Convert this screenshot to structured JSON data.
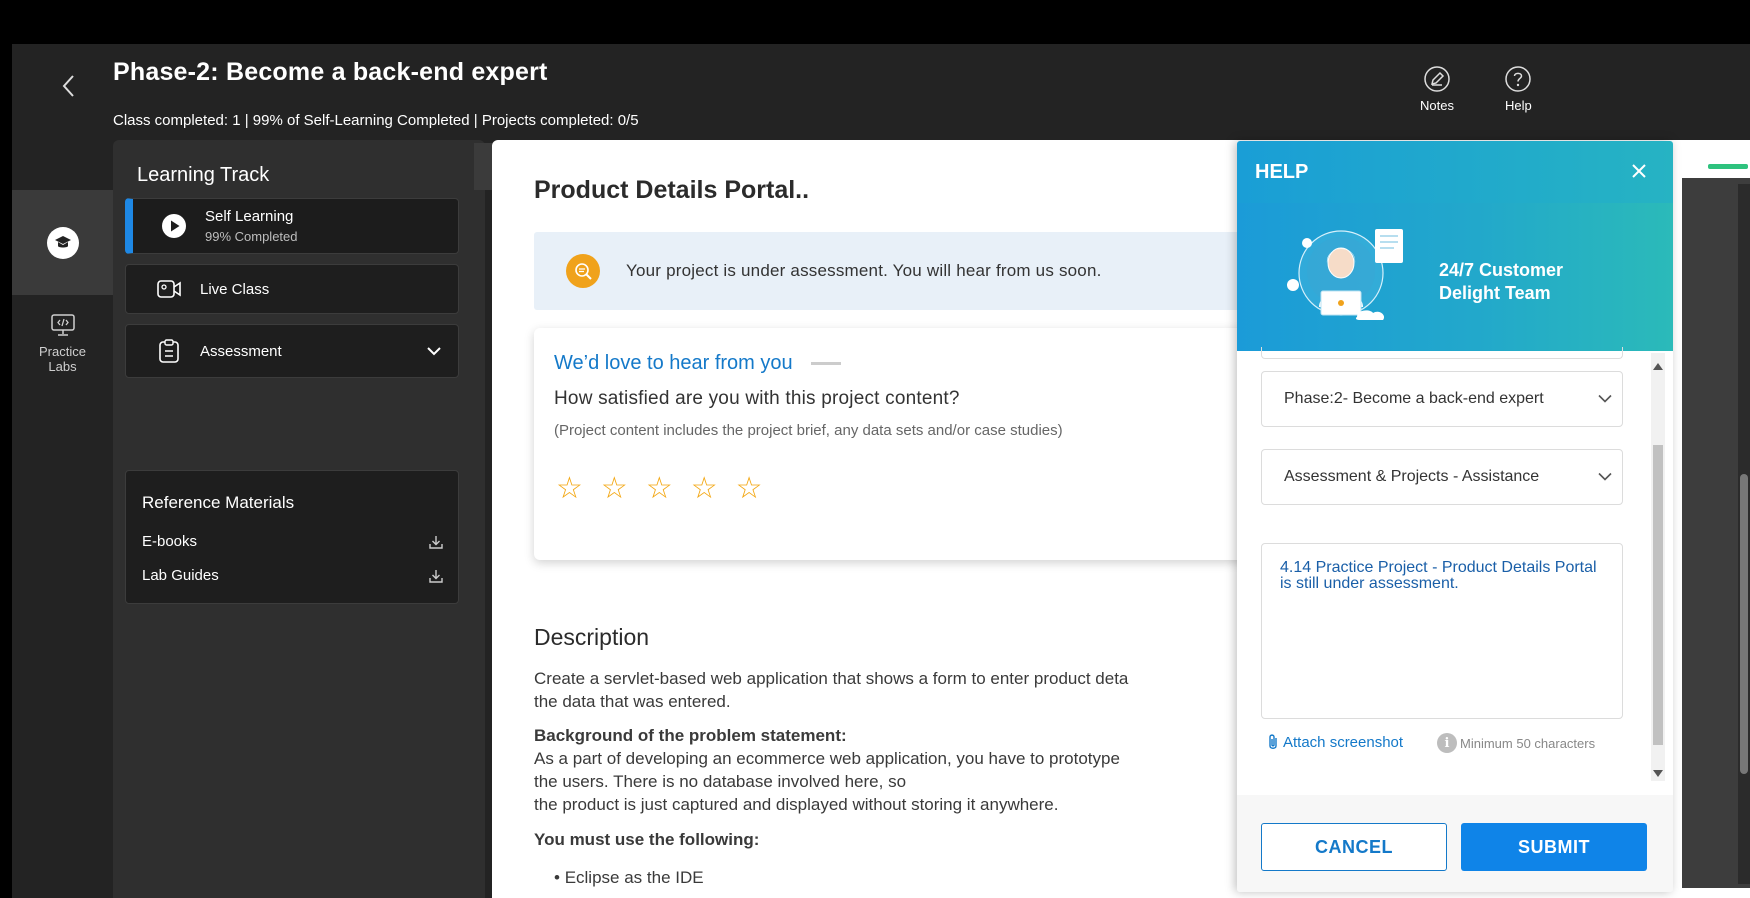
{
  "header": {
    "title": "Phase-2: Become a back-end expert",
    "progress": "Class completed: 1 | 99% of Self-Learning Completed  | Projects completed: 0/5",
    "notes_label": "Notes",
    "help_label": "Help"
  },
  "rail": {
    "labs_label": "Practice Labs"
  },
  "track": {
    "title": "Learning Track",
    "items": [
      {
        "label": "Self Learning",
        "sub": "99% Completed",
        "icon": "play-icon"
      },
      {
        "label": "Live Class",
        "icon": "video-icon"
      },
      {
        "label": "Assessment",
        "icon": "clipboard-icon"
      }
    ],
    "reference": {
      "title": "Reference Materials",
      "items": [
        {
          "label": "E-books",
          "icon": "download-icon"
        },
        {
          "label": "Lab Guides",
          "icon": "download-icon"
        }
      ]
    }
  },
  "main": {
    "project_title": "Product Details Portal..",
    "assessment_notice": "Your project is under assessment. You will hear from us soon.",
    "feedback": {
      "title": "We’d love to hear from you",
      "question": "How satisfied are you with this project content?",
      "note": "(Project content includes the project brief, any data sets and/or case studies)",
      "rating": 0,
      "max_rating": 5
    },
    "description": {
      "heading": "Description",
      "line1": "Create a servlet-based web application that shows a form to enter product deta",
      "line2": "the data that was entered.",
      "bg_heading": "Background of the problem statement:",
      "bg_line1": "As a part of developing an ecommerce web application, you have to prototype",
      "bg_line2": "the users. There is no database involved here, so",
      "bg_line3": "the product is just captured and displayed without storing it anywhere.",
      "must_heading": "You must use the following:",
      "bullet1": "Eclipse as the IDE"
    }
  },
  "help": {
    "title": "HELP",
    "team": "24/7 Customer Delight Team",
    "course_select": "Phase:2- Become a back-end expert",
    "category_select": "Assessment & Projects - Assistance",
    "message": "4.14 Practice Project - Product Details Portal is still under assessment.",
    "attach_label": "Attach screenshot",
    "min_chars": "Minimum 50 characters",
    "cancel_label": "CANCEL",
    "submit_label": "SUBMIT"
  },
  "colors": {
    "accent_blue": "#0f84e8",
    "link_blue": "#1479c9",
    "star": "#f3a712",
    "assessment_icon": "#f0a21b",
    "progress_green": "#2ec27e"
  }
}
